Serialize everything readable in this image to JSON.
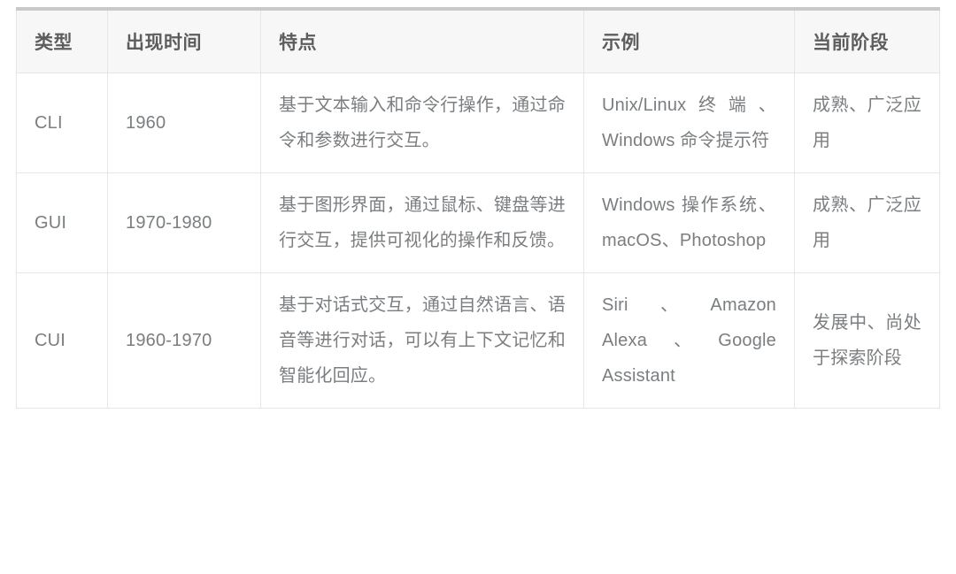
{
  "table": {
    "caption": "",
    "columns": [
      {
        "key": "type",
        "label": "类型"
      },
      {
        "key": "time",
        "label": "出现时间"
      },
      {
        "key": "feature",
        "label": "特点"
      },
      {
        "key": "example",
        "label": "示例"
      },
      {
        "key": "stage",
        "label": "当前阶段"
      }
    ],
    "rows": [
      {
        "type": "CLI",
        "time": "1960",
        "feature": "基于文本输入和命令行操作，通过命令和参数进行交互。",
        "example": "Unix/Linux终端、Windows 命令提示符",
        "stage": "成熟、广泛应用"
      },
      {
        "type": "GUI",
        "time": "1970-1980",
        "feature": "基于图形界面，通过鼠标、键盘等进行交互，提供可视化的操作和反馈。",
        "example": "Windows 操作系统、macOS、Photoshop",
        "stage": "成熟、广泛应用"
      },
      {
        "type": "CUI",
        "time": "1960-1970",
        "feature": "基于对话式交互，通过自然语言、语音等进行对话，可以有上下文记忆和智能化回应。",
        "example": "Siri、Amazon Alexa、Google Assistant",
        "stage": "发展中、尚处于探索阶段"
      }
    ]
  },
  "colors": {
    "header_background": "#f7f7f7",
    "header_text": "#5d5d5d",
    "body_text": "#7b7e80",
    "border": "#e6e6e6",
    "top_border": "#c7c9cb",
    "page_background": "#ffffff"
  }
}
